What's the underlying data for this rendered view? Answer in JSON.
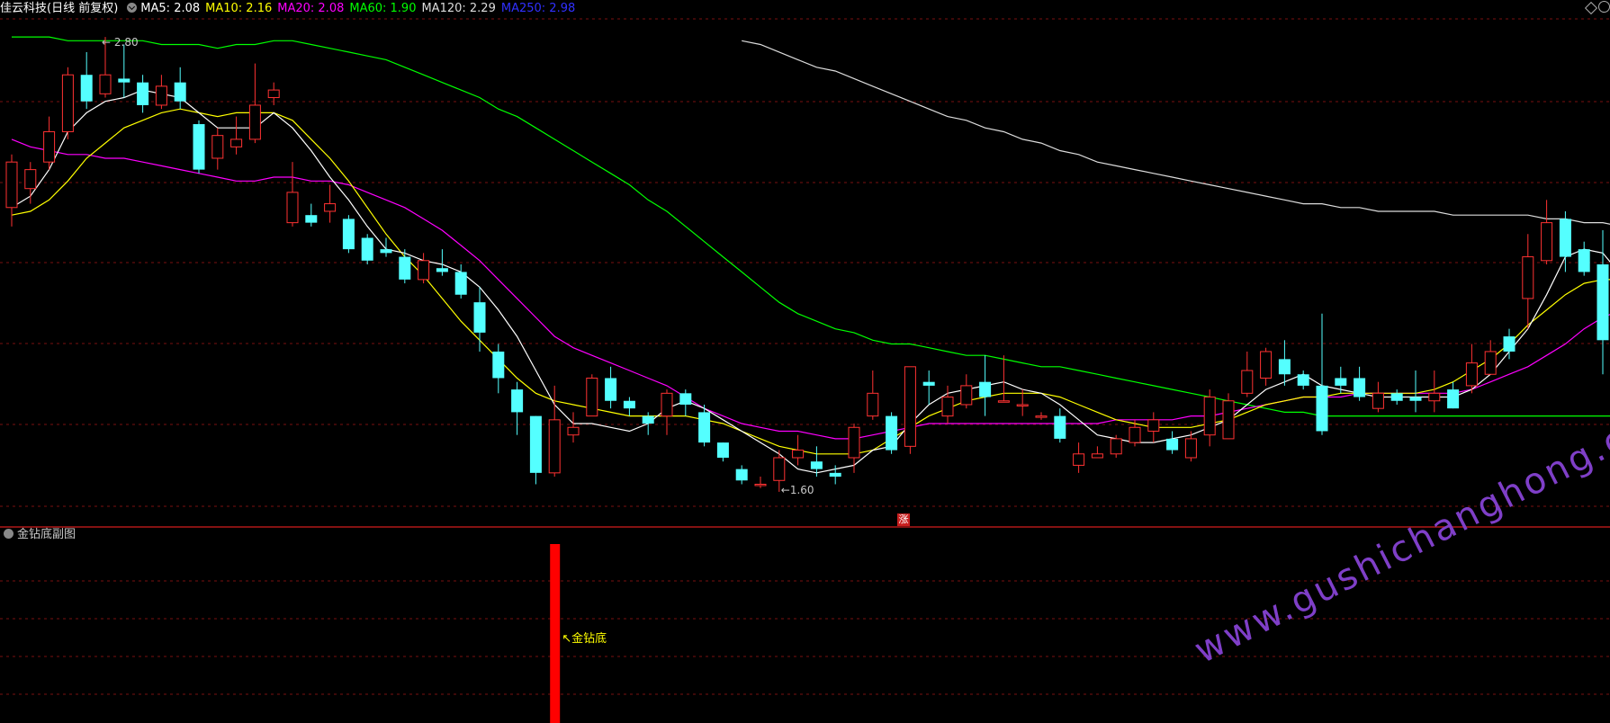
{
  "header": {
    "stock_name": "佳云科技",
    "period": "(日线 前复权)",
    "ma": [
      {
        "label": "MA5: 2.08",
        "color": "#ffffff"
      },
      {
        "label": "MA10: 2.16",
        "color": "#ffff00"
      },
      {
        "label": "MA20: 2.08",
        "color": "#ff00ff"
      },
      {
        "label": "MA60: 1.90",
        "color": "#00ff00"
      },
      {
        "label": "MA120: 2.29",
        "color": "#dcdcdc"
      },
      {
        "label": "MA250: 2.98",
        "color": "#0000ff"
      }
    ]
  },
  "sub_panel": {
    "title": "金钻底副图",
    "signal_label": "金钻底"
  },
  "zhang_label": "涨",
  "watermark": "www.gushichanghong.com",
  "colors": {
    "up": "#ff3232",
    "down": "#54ffff",
    "grid": "#7a1010",
    "ma5": "#ffffff",
    "ma10": "#ffff00",
    "ma20": "#ff00ff",
    "ma60": "#00ff00",
    "ma120": "#dcdcdc",
    "signal": "#ff0000",
    "signal_label": "#ffff00"
  },
  "chart_data": {
    "type": "candlestick",
    "price_range": [
      1.55,
      2.85
    ],
    "high_label": "2.80",
    "low_label": "1.60",
    "candles": [
      [
        2.35,
        2.47,
        2.49,
        2.3
      ],
      [
        2.4,
        2.45,
        2.47,
        2.36
      ],
      [
        2.47,
        2.55,
        2.59,
        2.45
      ],
      [
        2.55,
        2.7,
        2.72,
        2.53
      ],
      [
        2.7,
        2.63,
        2.76,
        2.61
      ],
      [
        2.65,
        2.7,
        2.8,
        2.64
      ],
      [
        2.69,
        2.68,
        2.78,
        2.64
      ],
      [
        2.68,
        2.62,
        2.7,
        2.6
      ],
      [
        2.62,
        2.67,
        2.7,
        2.61
      ],
      [
        2.68,
        2.63,
        2.72,
        2.61
      ],
      [
        2.57,
        2.45,
        2.58,
        2.44
      ],
      [
        2.48,
        2.54,
        2.56,
        2.45
      ],
      [
        2.51,
        2.53,
        2.59,
        2.49
      ],
      [
        2.53,
        2.62,
        2.73,
        2.52
      ],
      [
        2.64,
        2.66,
        2.68,
        2.62
      ],
      [
        2.31,
        2.39,
        2.47,
        2.3
      ],
      [
        2.33,
        2.31,
        2.36,
        2.3
      ],
      [
        2.34,
        2.36,
        2.41,
        2.31
      ],
      [
        2.32,
        2.24,
        2.33,
        2.23
      ],
      [
        2.27,
        2.21,
        2.28,
        2.2
      ],
      [
        2.24,
        2.23,
        2.27,
        2.22
      ],
      [
        2.22,
        2.16,
        2.24,
        2.15
      ],
      [
        2.16,
        2.21,
        2.23,
        2.15
      ],
      [
        2.19,
        2.18,
        2.24,
        2.17
      ],
      [
        2.18,
        2.12,
        2.2,
        2.11
      ],
      [
        2.1,
        2.02,
        2.14,
        1.97
      ],
      [
        1.97,
        1.9,
        1.99,
        1.86
      ],
      [
        1.87,
        1.81,
        1.89,
        1.75
      ],
      [
        1.8,
        1.65,
        1.8,
        1.62
      ],
      [
        1.65,
        1.79,
        1.88,
        1.64
      ],
      [
        1.75,
        1.77,
        1.81,
        1.73
      ],
      [
        1.8,
        1.9,
        1.91,
        1.8
      ],
      [
        1.9,
        1.84,
        1.93,
        1.82
      ],
      [
        1.84,
        1.82,
        1.85,
        1.8
      ],
      [
        1.8,
        1.78,
        1.81,
        1.75
      ],
      [
        1.8,
        1.86,
        1.87,
        1.75
      ],
      [
        1.86,
        1.83,
        1.87,
        1.8
      ],
      [
        1.81,
        1.73,
        1.83,
        1.72
      ],
      [
        1.73,
        1.69,
        1.73,
        1.68
      ],
      [
        1.66,
        1.63,
        1.67,
        1.62
      ],
      [
        1.62,
        1.62,
        1.64,
        1.61
      ],
      [
        1.63,
        1.69,
        1.71,
        1.6
      ],
      [
        1.69,
        1.71,
        1.75,
        1.67
      ],
      [
        1.68,
        1.66,
        1.72,
        1.64
      ],
      [
        1.65,
        1.64,
        1.67,
        1.62
      ],
      [
        1.69,
        1.77,
        1.78,
        1.65
      ],
      [
        1.8,
        1.86,
        1.92,
        1.79
      ],
      [
        1.8,
        1.71,
        1.81,
        1.7
      ],
      [
        1.72,
        1.93,
        1.93,
        1.7
      ],
      [
        1.89,
        1.88,
        1.92,
        1.83
      ],
      [
        1.8,
        1.85,
        1.88,
        1.78
      ],
      [
        1.83,
        1.88,
        1.91,
        1.82
      ],
      [
        1.89,
        1.85,
        1.96,
        1.8
      ],
      [
        1.84,
        1.84,
        1.96,
        1.84
      ],
      [
        1.83,
        1.83,
        1.87,
        1.8
      ],
      [
        1.8,
        1.8,
        1.81,
        1.79
      ],
      [
        1.8,
        1.74,
        1.82,
        1.73
      ],
      [
        1.67,
        1.7,
        1.73,
        1.65
      ],
      [
        1.69,
        1.7,
        1.72,
        1.69
      ],
      [
        1.7,
        1.74,
        1.75,
        1.69
      ],
      [
        1.73,
        1.77,
        1.79,
        1.72
      ],
      [
        1.76,
        1.79,
        1.81,
        1.73
      ],
      [
        1.74,
        1.71,
        1.76,
        1.7
      ],
      [
        1.69,
        1.74,
        1.76,
        1.68
      ],
      [
        1.75,
        1.85,
        1.87,
        1.72
      ],
      [
        1.74,
        1.84,
        1.86,
        1.74
      ],
      [
        1.86,
        1.92,
        1.97,
        1.85
      ],
      [
        1.9,
        1.97,
        1.98,
        1.88
      ],
      [
        1.95,
        1.91,
        2.0,
        1.88
      ],
      [
        1.91,
        1.88,
        1.92,
        1.87
      ],
      [
        1.88,
        1.76,
        2.07,
        1.75
      ],
      [
        1.9,
        1.88,
        1.93,
        1.86
      ],
      [
        1.9,
        1.85,
        1.93,
        1.84
      ],
      [
        1.82,
        1.86,
        1.89,
        1.81
      ],
      [
        1.86,
        1.84,
        1.87,
        1.83
      ],
      [
        1.85,
        1.84,
        1.92,
        1.81
      ],
      [
        1.84,
        1.86,
        1.92,
        1.81
      ],
      [
        1.87,
        1.82,
        1.89,
        1.82
      ],
      [
        1.88,
        1.94,
        1.99,
        1.86
      ],
      [
        1.91,
        1.97,
        2.0,
        1.91
      ],
      [
        2.01,
        1.97,
        2.03,
        1.95
      ],
      [
        2.11,
        2.22,
        2.28,
        2.03
      ],
      [
        2.21,
        2.31,
        2.37,
        2.2
      ],
      [
        2.32,
        2.22,
        2.34,
        2.18
      ],
      [
        2.24,
        2.18,
        2.26,
        2.17
      ],
      [
        2.2,
        2.0,
        2.29,
        1.91
      ],
      [
        1.98,
        2.09,
        2.12,
        1.96
      ]
    ],
    "ma5": [
      2.35,
      2.38,
      2.45,
      2.55,
      2.6,
      2.63,
      2.64,
      2.66,
      2.65,
      2.64,
      2.6,
      2.56,
      2.56,
      2.56,
      2.6,
      2.56,
      2.5,
      2.43,
      2.37,
      2.3,
      2.24,
      2.23,
      2.21,
      2.2,
      2.18,
      2.14,
      2.08,
      2.01,
      1.92,
      1.83,
      1.78,
      1.78,
      1.77,
      1.76,
      1.78,
      1.82,
      1.84,
      1.82,
      1.79,
      1.76,
      1.73,
      1.7,
      1.66,
      1.65,
      1.66,
      1.67,
      1.71,
      1.72,
      1.78,
      1.83,
      1.86,
      1.87,
      1.88,
      1.89,
      1.87,
      1.86,
      1.83,
      1.79,
      1.75,
      1.74,
      1.73,
      1.73,
      1.74,
      1.75,
      1.77,
      1.79,
      1.83,
      1.87,
      1.89,
      1.91,
      1.88,
      1.87,
      1.86,
      1.85,
      1.85,
      1.85,
      1.85,
      1.85,
      1.87,
      1.91,
      1.97,
      2.03,
      2.12,
      2.22,
      2.24,
      2.23,
      2.17
    ],
    "ma10": [
      2.33,
      2.34,
      2.37,
      2.42,
      2.48,
      2.52,
      2.56,
      2.58,
      2.6,
      2.61,
      2.6,
      2.59,
      2.6,
      2.6,
      2.6,
      2.58,
      2.53,
      2.48,
      2.42,
      2.35,
      2.28,
      2.22,
      2.17,
      2.11,
      2.05,
      2.0,
      1.95,
      1.9,
      1.86,
      1.84,
      1.83,
      1.82,
      1.81,
      1.8,
      1.8,
      1.8,
      1.8,
      1.79,
      1.78,
      1.76,
      1.74,
      1.72,
      1.71,
      1.7,
      1.7,
      1.7,
      1.71,
      1.74,
      1.77,
      1.8,
      1.82,
      1.84,
      1.85,
      1.86,
      1.86,
      1.86,
      1.85,
      1.83,
      1.81,
      1.79,
      1.78,
      1.77,
      1.77,
      1.77,
      1.78,
      1.79,
      1.81,
      1.83,
      1.84,
      1.85,
      1.85,
      1.86,
      1.86,
      1.86,
      1.86,
      1.86,
      1.87,
      1.89,
      1.92,
      1.95,
      1.99,
      2.04,
      2.08,
      2.12,
      2.15,
      2.16,
      2.16
    ],
    "ma20": [
      2.53,
      2.51,
      2.5,
      2.49,
      2.49,
      2.48,
      2.48,
      2.47,
      2.46,
      2.45,
      2.44,
      2.43,
      2.42,
      2.42,
      2.43,
      2.43,
      2.42,
      2.42,
      2.41,
      2.39,
      2.37,
      2.35,
      2.32,
      2.29,
      2.25,
      2.21,
      2.16,
      2.11,
      2.06,
      2.01,
      1.98,
      1.96,
      1.94,
      1.92,
      1.9,
      1.88,
      1.85,
      1.82,
      1.8,
      1.78,
      1.77,
      1.76,
      1.76,
      1.75,
      1.74,
      1.74,
      1.75,
      1.76,
      1.77,
      1.78,
      1.78,
      1.78,
      1.78,
      1.78,
      1.78,
      1.78,
      1.78,
      1.78,
      1.78,
      1.79,
      1.79,
      1.79,
      1.79,
      1.8,
      1.8,
      1.81,
      1.82,
      1.83,
      1.84,
      1.85,
      1.85,
      1.85,
      1.86,
      1.86,
      1.86,
      1.86,
      1.86,
      1.86,
      1.87,
      1.89,
      1.91,
      1.93,
      1.96,
      1.99,
      2.03,
      2.06,
      2.08
    ],
    "ma60": [
      2.8,
      2.8,
      2.8,
      2.79,
      2.79,
      2.79,
      2.79,
      2.79,
      2.78,
      2.78,
      2.78,
      2.77,
      2.78,
      2.78,
      2.79,
      2.79,
      2.78,
      2.77,
      2.76,
      2.75,
      2.74,
      2.72,
      2.7,
      2.68,
      2.66,
      2.64,
      2.61,
      2.59,
      2.56,
      2.53,
      2.5,
      2.47,
      2.44,
      2.41,
      2.37,
      2.34,
      2.3,
      2.26,
      2.22,
      2.18,
      2.14,
      2.1,
      2.07,
      2.05,
      2.03,
      2.02,
      2.0,
      1.99,
      1.99,
      1.98,
      1.97,
      1.96,
      1.96,
      1.95,
      1.94,
      1.93,
      1.93,
      1.92,
      1.91,
      1.9,
      1.89,
      1.88,
      1.87,
      1.86,
      1.85,
      1.84,
      1.83,
      1.82,
      1.81,
      1.81,
      1.8,
      1.8,
      1.8,
      1.8,
      1.8,
      1.8,
      1.8,
      1.8,
      1.8,
      1.8,
      1.8,
      1.8,
      1.8,
      1.8,
      1.8,
      1.8,
      1.8
    ],
    "ma120": [
      null,
      null,
      null,
      null,
      null,
      null,
      null,
      null,
      null,
      null,
      null,
      null,
      null,
      null,
      null,
      null,
      null,
      null,
      null,
      null,
      null,
      null,
      null,
      null,
      null,
      null,
      null,
      null,
      null,
      null,
      null,
      null,
      null,
      null,
      null,
      null,
      null,
      null,
      null,
      2.79,
      2.78,
      2.76,
      2.74,
      2.72,
      2.71,
      2.69,
      2.67,
      2.65,
      2.63,
      2.61,
      2.59,
      2.58,
      2.56,
      2.55,
      2.53,
      2.52,
      2.5,
      2.49,
      2.47,
      2.46,
      2.45,
      2.44,
      2.43,
      2.42,
      2.41,
      2.4,
      2.39,
      2.38,
      2.37,
      2.36,
      2.36,
      2.35,
      2.35,
      2.34,
      2.34,
      2.34,
      2.34,
      2.33,
      2.33,
      2.33,
      2.33,
      2.33,
      2.32,
      2.32,
      2.31,
      2.31,
      2.3,
      2.3
    ],
    "signal_index": 29
  }
}
